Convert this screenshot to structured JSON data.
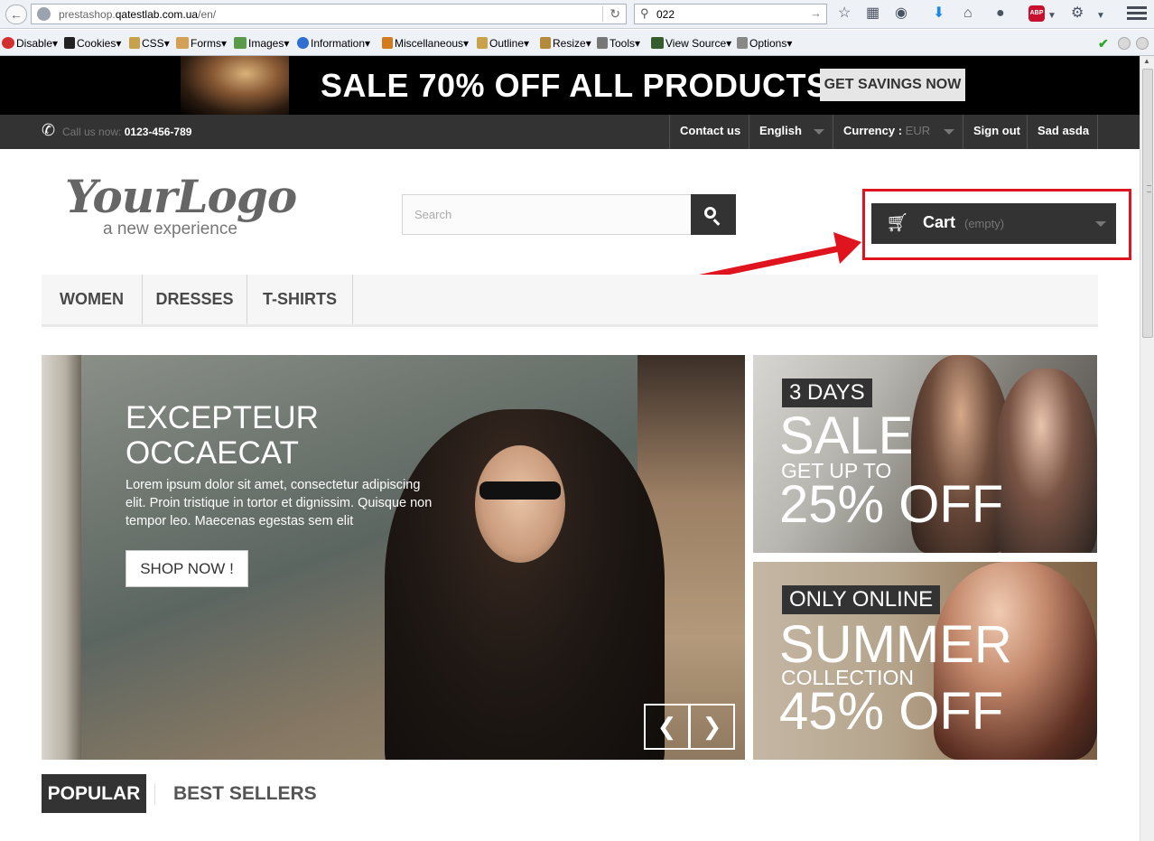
{
  "browser": {
    "url_prefix": "prestashop.",
    "url_domain": "qatestlab.com.ua",
    "url_path": "/en/",
    "search_value": "022"
  },
  "devbar": {
    "items": [
      "Disable",
      "Cookies",
      "CSS",
      "Forms",
      "Images",
      "Information",
      "Miscellaneous",
      "Outline",
      "Resize",
      "Tools",
      "View Source",
      "Options"
    ]
  },
  "banner": {
    "headline": "SALE 70% OFF ALL PRODUCTS",
    "cta": "GET SAVINGS NOW"
  },
  "topnav": {
    "call_label": "Call us now:",
    "phone": "0123-456-789",
    "contact": "Contact us",
    "language": "English",
    "currency_label": "Currency :",
    "currency_value": "EUR",
    "sign_out": "Sign out",
    "user": "Sad asda"
  },
  "header": {
    "logo_main": "YourLogo",
    "logo_tagline": "a new experience",
    "search_placeholder": "Search",
    "cart_label": "Cart",
    "cart_status": "(empty)"
  },
  "menu": [
    "WOMEN",
    "DRESSES",
    "T-SHIRTS"
  ],
  "slider": {
    "title_line1": "EXCEPTEUR",
    "title_line2": "OCCAECAT",
    "text": "Lorem ipsum dolor sit amet, consectetur adipiscing elit. Proin tristique in tortor et dignissim. Quisque non tempor leo. Maecenas egestas sem elit",
    "button": "SHOP NOW !"
  },
  "promos": [
    {
      "tag": "3 DAYS",
      "big": "SALE",
      "mid": "GET UP TO",
      "big2": "25% OFF"
    },
    {
      "tag": "ONLY ONLINE",
      "big": "SUMMER",
      "mid": "COLLECTION",
      "big2": "45% OFF"
    }
  ],
  "tabs": [
    "POPULAR",
    "BEST SELLERS"
  ],
  "colors": {
    "annotation": "#e0141e",
    "dark": "#333333"
  },
  "icons": {
    "phone": "phone-icon",
    "cart": "cart-icon",
    "search": "search-icon",
    "slider_prev": "chevron-left-icon",
    "slider_next": "chevron-right-icon"
  }
}
